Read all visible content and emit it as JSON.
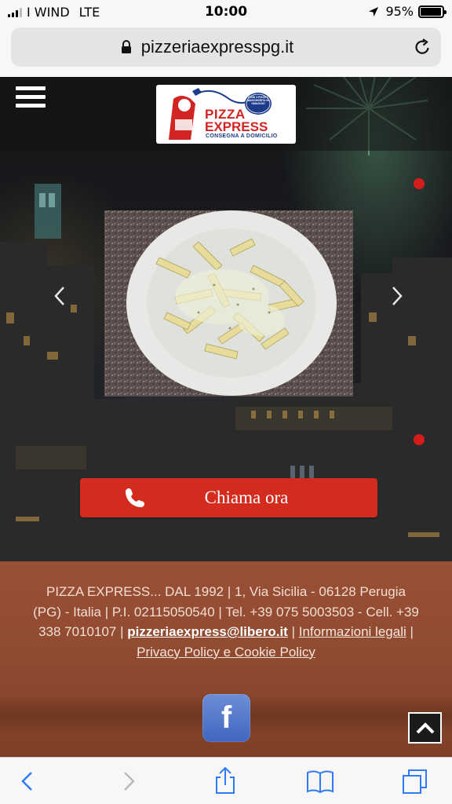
{
  "status_bar": {
    "carrier": "I WIND",
    "network": "LTE",
    "time": "10:00",
    "battery_percent_label": "95%",
    "battery_level": 0.95
  },
  "browser": {
    "url": "pizzeriaexpresspg.it"
  },
  "header": {
    "logo": {
      "line1": "PIZZA",
      "line2": "EXPRESS",
      "tagline": "CONSEGNA A DOMICILIO",
      "badge": "OGNI 4 PIZZE 1 MARGHERITA IN OMAGGIO"
    }
  },
  "slider": {
    "photo_subject": "penne pasta with creamy sauce on white plate"
  },
  "cta": {
    "call_label": "Chiama ora"
  },
  "footer": {
    "line_text_1": "PIZZA EXPRESS... DAL 1992 | 1, Via Sicilia - 06128 Perugia (PG) - Italia | P.I. 02115050540 | Tel. +39 075 5003503    - Cell. +39 338 7010107 |",
    "email": "pizzeriaexpress@libero.it",
    "sep1": " | ",
    "legal_link": "Informazioni legali",
    "sep2": " |",
    "privacy_link": "Privacy Policy e Cookie Policy",
    "facebook_letter": "f"
  },
  "colors": {
    "accent_red": "#d42b1f",
    "dot_red": "#d61d1d",
    "footer_brown": "#8e4a30",
    "facebook_blue": "#3f66bf",
    "ios_blue": "#2f7cf6"
  },
  "icons": {
    "menu": "hamburger-icon",
    "lock": "lock-icon",
    "reload": "reload-icon",
    "phone": "phone-icon",
    "facebook": "facebook-icon",
    "back_to_top": "chevron-up-icon",
    "back": "chevron-left-icon",
    "forward": "chevron-right-icon",
    "share": "share-icon",
    "bookmarks": "book-icon",
    "tabs": "tabs-icon"
  }
}
